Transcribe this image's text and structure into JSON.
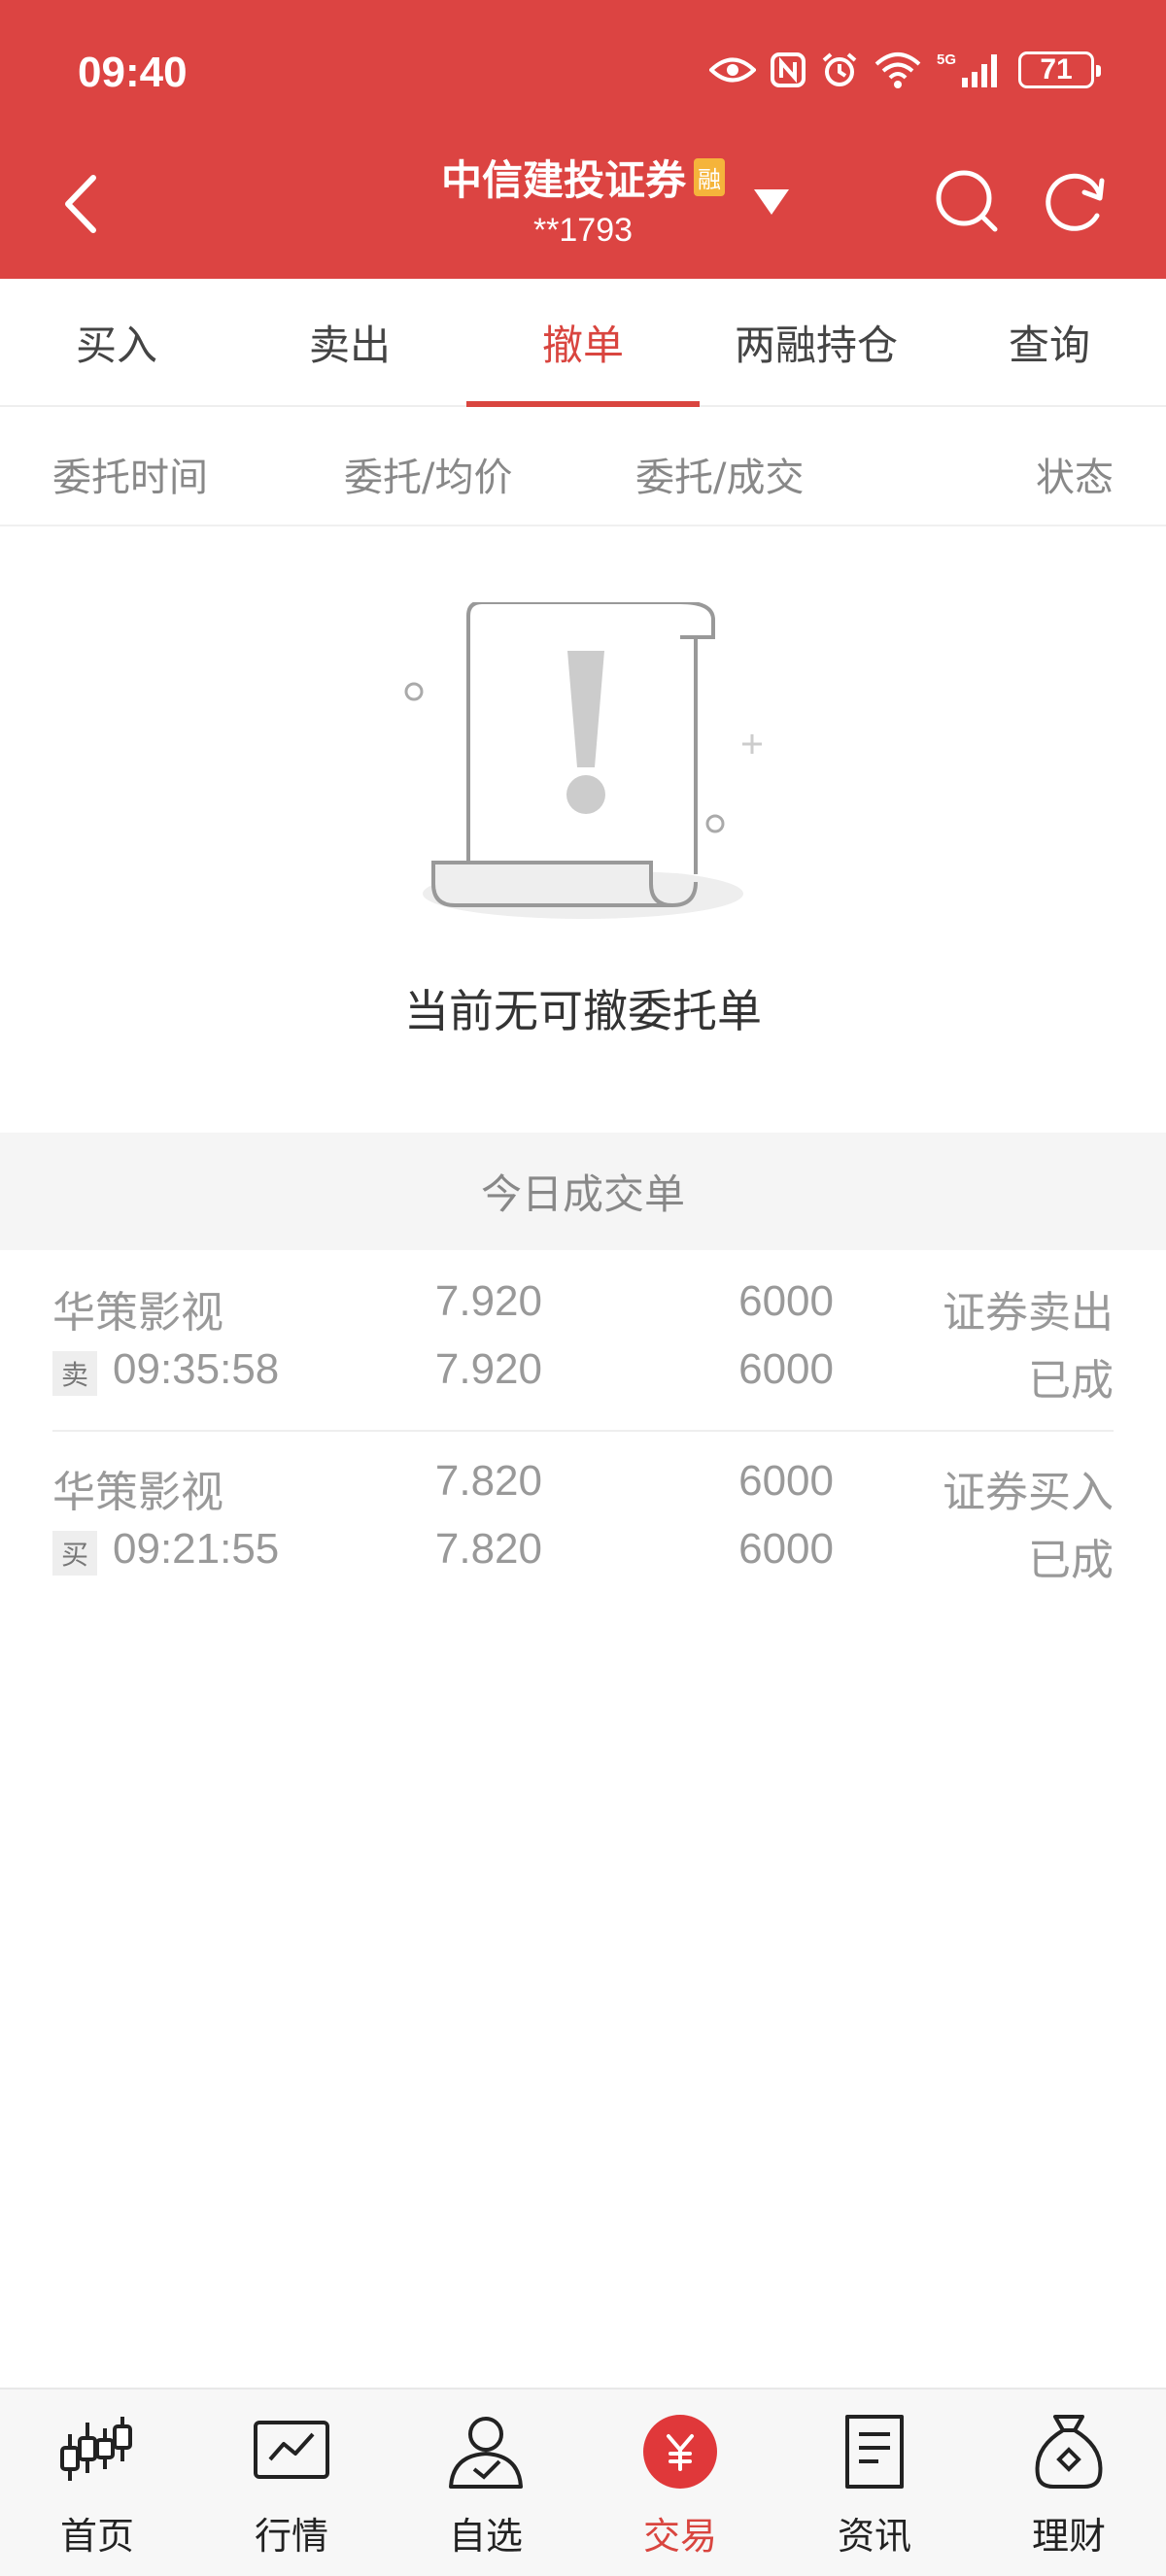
{
  "status_bar": {
    "time": "09:40",
    "battery": "71"
  },
  "header": {
    "broker_name": "中信建投证券",
    "badge": "融",
    "account": "**1793",
    "icons": [
      "back-icon",
      "chevron-down-icon",
      "search-icon",
      "refresh-icon"
    ]
  },
  "tabs": [
    {
      "label": "买入",
      "active": false
    },
    {
      "label": "卖出",
      "active": false
    },
    {
      "label": "撤单",
      "active": true
    },
    {
      "label": "两融持仓",
      "active": false
    },
    {
      "label": "查询",
      "active": false
    }
  ],
  "columns": [
    "委托时间",
    "委托/均价",
    "委托/成交",
    "状态"
  ],
  "empty_state": {
    "message": "当前无可撤委托单"
  },
  "today_trades": {
    "title": "今日成交单",
    "rows": [
      {
        "name": "华策影视",
        "side": "卖",
        "time": "09:35:58",
        "order_price": "7.920",
        "avg_price": "7.920",
        "order_qty": "6000",
        "filled_qty": "6000",
        "type": "证券卖出",
        "status": "已成"
      },
      {
        "name": "华策影视",
        "side": "买",
        "time": "09:21:55",
        "order_price": "7.820",
        "avg_price": "7.820",
        "order_qty": "6000",
        "filled_qty": "6000",
        "type": "证券买入",
        "status": "已成"
      }
    ]
  },
  "bottom_nav": [
    {
      "label": "首页",
      "icon": "candlestick-icon",
      "active": false
    },
    {
      "label": "行情",
      "icon": "chart-icon",
      "active": false
    },
    {
      "label": "自选",
      "icon": "user-check-icon",
      "active": false
    },
    {
      "label": "交易",
      "icon": "yuan-icon",
      "active": true
    },
    {
      "label": "资讯",
      "icon": "document-icon",
      "active": false
    },
    {
      "label": "理财",
      "icon": "money-bag-icon",
      "active": false
    }
  ],
  "colors": {
    "brand_red": "#dc4442",
    "active_red": "#d9453f",
    "badge_orange": "#f5b43b"
  }
}
